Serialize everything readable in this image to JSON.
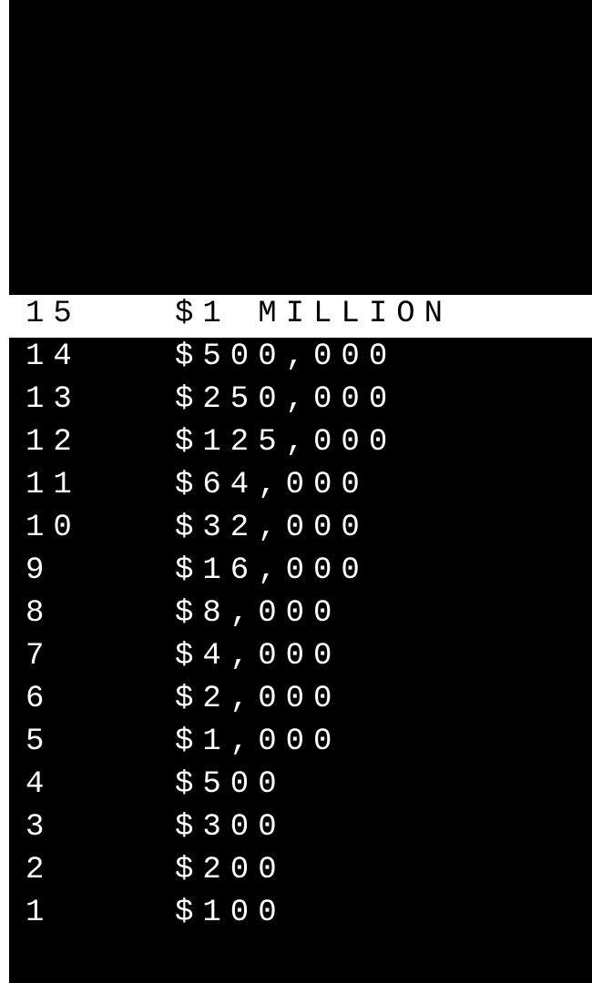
{
  "colors": {
    "background": "#000000",
    "text": "#ffffff",
    "highlight_background": "#ffffff",
    "highlight_text": "#000000"
  },
  "current_level": "15",
  "ladder": [
    {
      "level": "15",
      "amount": "$1 MILLION"
    },
    {
      "level": "14",
      "amount": "$500,000"
    },
    {
      "level": "13",
      "amount": "$250,000"
    },
    {
      "level": "12",
      "amount": "$125,000"
    },
    {
      "level": "11",
      "amount": "$64,000"
    },
    {
      "level": "10",
      "amount": "$32,000"
    },
    {
      "level": "9",
      "amount": "$16,000"
    },
    {
      "level": "8",
      "amount": "$8,000"
    },
    {
      "level": "7",
      "amount": "$4,000"
    },
    {
      "level": "6",
      "amount": "$2,000"
    },
    {
      "level": "5",
      "amount": "$1,000"
    },
    {
      "level": "4",
      "amount": "$500"
    },
    {
      "level": "3",
      "amount": "$300"
    },
    {
      "level": "2",
      "amount": "$200"
    },
    {
      "level": "1",
      "amount": "$100"
    }
  ]
}
